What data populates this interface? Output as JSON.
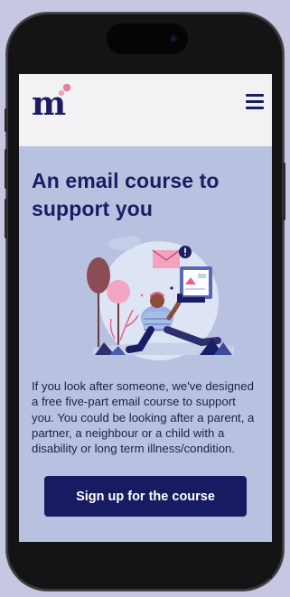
{
  "header": {
    "logo_text": "m",
    "menu_icon": "hamburger-menu-icon"
  },
  "hero": {
    "heading": "An email course to support you",
    "illustration": "person-with-phone-and-email-illustration",
    "body": "If you look after someone, we've designed a free five-part email course to support you. You could be looking after a parent, a partner, a neighbour or a child with a disability or long term illness/condition.",
    "cta_label": "Sign up for the course"
  },
  "colors": {
    "brand_navy": "#1b1d63",
    "logo_dot_pink": "#e87d9f",
    "page_background": "#b9c1e0",
    "header_background": "#f2f2f4",
    "cta_background": "#181a62"
  }
}
